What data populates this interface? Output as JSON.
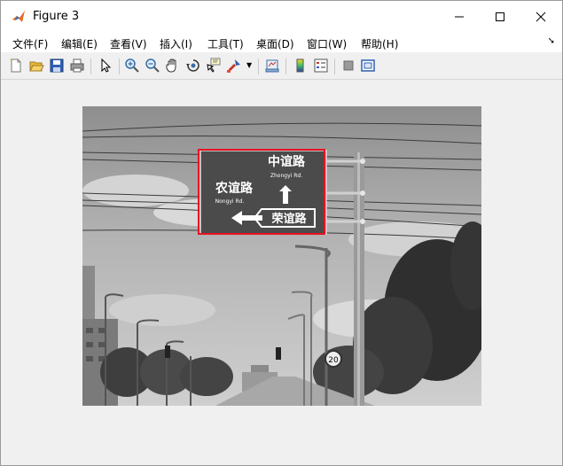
{
  "window": {
    "title": "Figure 3"
  },
  "menu": {
    "items": [
      {
        "label": "文件(F)"
      },
      {
        "label": "编辑(E)"
      },
      {
        "label": "查看(V)"
      },
      {
        "label": "插入(I)"
      },
      {
        "label": "工具(T)"
      },
      {
        "label": "桌面(D)"
      },
      {
        "label": "窗口(W)"
      },
      {
        "label": "帮助(H)"
      }
    ]
  },
  "image": {
    "sign": {
      "top_cn": "中谊路",
      "top_en": "Zhongyi  Rd.",
      "left_cn": "农谊路",
      "left_en": "Nongyi  Rd.",
      "bottom_cn": "荣谊路"
    },
    "speed_limit": "20"
  },
  "colors": {
    "roi": "#e81123",
    "accent": "#0078d7"
  }
}
